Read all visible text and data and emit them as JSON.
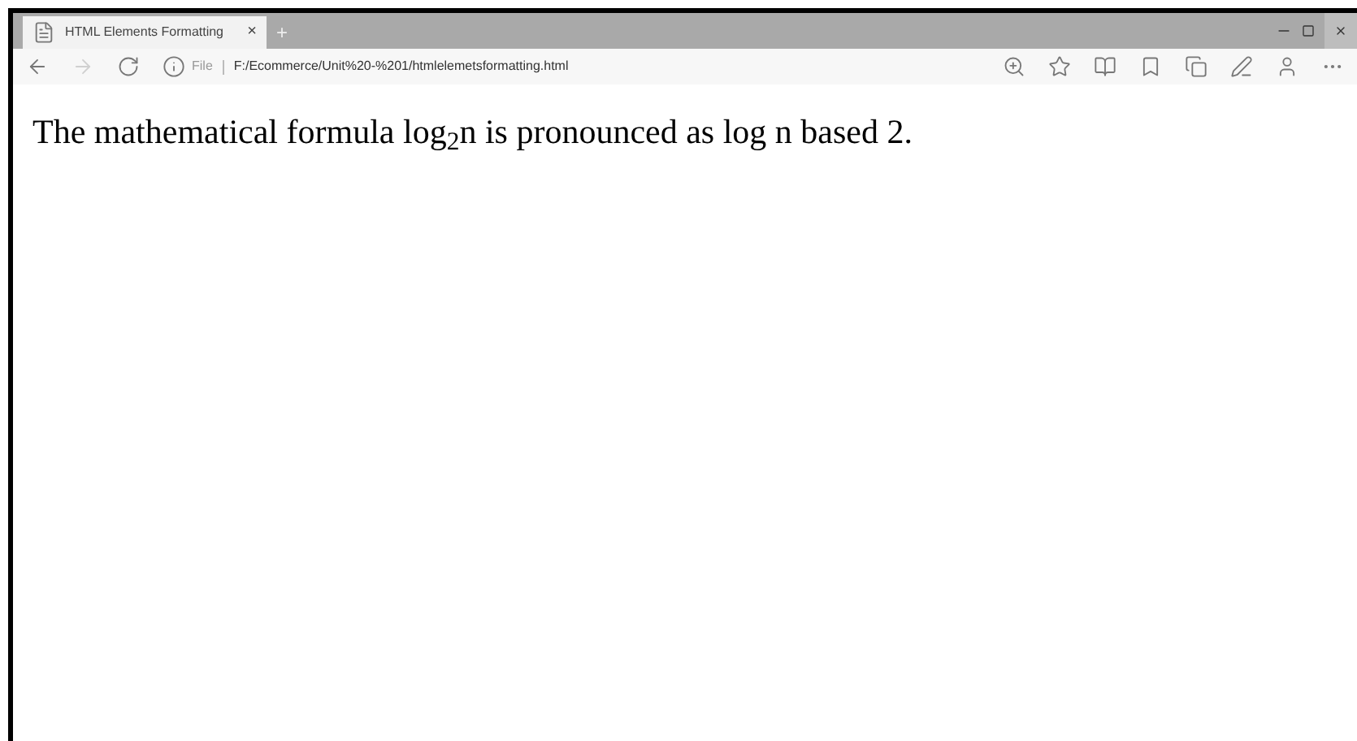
{
  "tab": {
    "title": "HTML Elements Formatting",
    "close": "×",
    "new_tab": "+"
  },
  "address_bar": {
    "scheme": "File",
    "url": "F:/Ecommerce/Unit%20-%201/htmlelemetsformatting.html"
  },
  "content": {
    "paragraph": "The mathematical formula log$_{2}$n is pronounced as log n based 2."
  }
}
